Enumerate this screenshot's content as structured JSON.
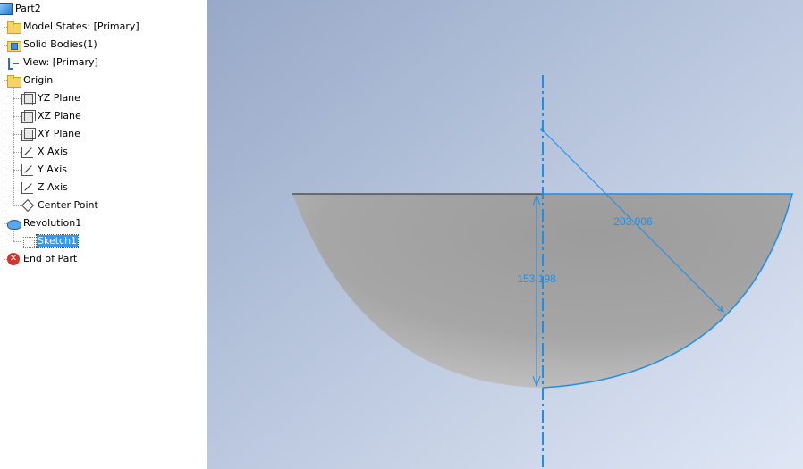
{
  "browser": {
    "items": [
      {
        "label": "Part2",
        "icon": "part-icon"
      },
      {
        "label": "Model States: [Primary]",
        "icon": "folder-icon"
      },
      {
        "label": "Solid Bodies(1)",
        "icon": "solid-bodies-icon"
      },
      {
        "label": "View: [Primary]",
        "icon": "view-icon"
      },
      {
        "label": "Origin",
        "icon": "folder-open-icon"
      },
      {
        "label": "YZ Plane",
        "icon": "plane-icon"
      },
      {
        "label": "XZ Plane",
        "icon": "plane-icon"
      },
      {
        "label": "XY Plane",
        "icon": "plane-icon"
      },
      {
        "label": "X Axis",
        "icon": "axis-icon"
      },
      {
        "label": "Y Axis",
        "icon": "axis-icon"
      },
      {
        "label": "Z Axis",
        "icon": "axis-icon"
      },
      {
        "label": "Center Point",
        "icon": "point-icon"
      },
      {
        "label": "Revolution1",
        "icon": "revolution-icon"
      },
      {
        "label": "Sketch1",
        "icon": "sketch-icon",
        "selected": true
      },
      {
        "label": "End of Part",
        "icon": "end-of-part-icon"
      }
    ]
  },
  "viewport": {
    "dimensions": {
      "vertical": "153.198",
      "diagonal": "203.906"
    },
    "colors": {
      "background_top": "#9aaccb",
      "background_bottom": "#dbe4f3",
      "part_face": "#a9a9a9",
      "sketch_blue": "#1e8fe8"
    }
  }
}
